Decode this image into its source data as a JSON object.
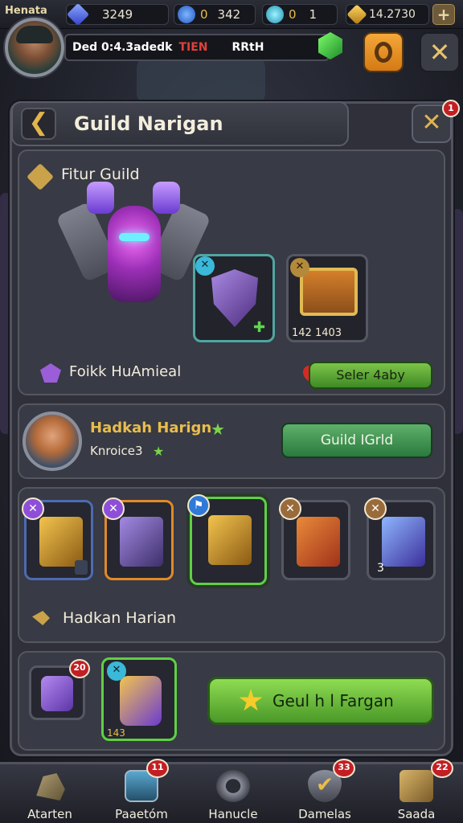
{
  "player": {
    "name": "Henata"
  },
  "resources": {
    "gems": "3249",
    "coins": "342",
    "coin_prefix": "0",
    "shards": "1",
    "shard_prefix": "0",
    "gold": "14.2730"
  },
  "profile": {
    "name_part1": "Ded 0:4.3adedk",
    "name_part2": "TIEN",
    "name_part3": "RRtH"
  },
  "header": {
    "title": "Guild Narigan",
    "close_badge": "1"
  },
  "featured": {
    "title": "Fitur Guild",
    "chest_timer": "142 1403",
    "subtitle": "Foikk HuAmieal",
    "select_button": "Seler 4aby"
  },
  "member": {
    "name": "Hadkah Harign",
    "subname": "Knroice3",
    "guild_button": "Guild IGrld"
  },
  "items": {
    "slot5_count": "3",
    "section_label": "Hadkan Harian"
  },
  "reward": {
    "badge1": "20",
    "count": "143",
    "claim_button": "Geul h l Fargan"
  },
  "nav": [
    {
      "label": "Atarten",
      "badge": ""
    },
    {
      "label": "Paaetóm",
      "badge": "11"
    },
    {
      "label": "Hanucle",
      "badge": ""
    },
    {
      "label": "Damelas",
      "badge": "33"
    },
    {
      "label": "Saada",
      "badge": "22"
    }
  ],
  "colors": {
    "accent_gold": "#e9bd4a",
    "button_green": "#7ec44a",
    "badge_red": "#c21f24"
  }
}
